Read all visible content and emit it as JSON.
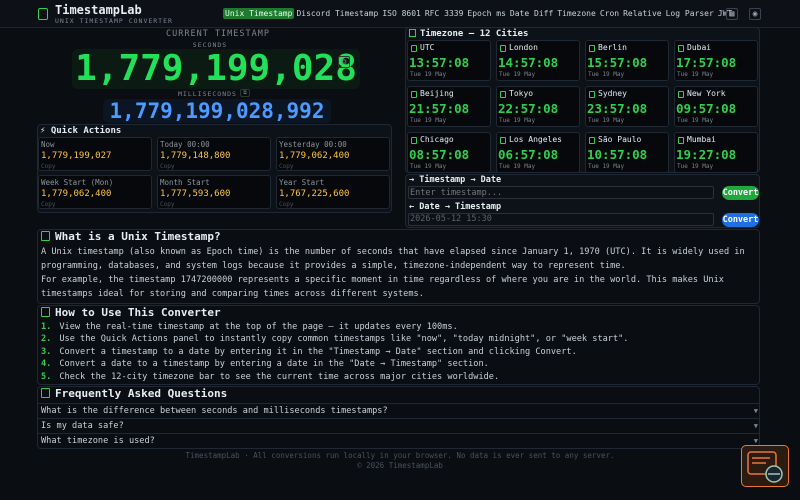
{
  "header": {
    "brand": "TimestampLab",
    "brand_sub": "UNIX TIMESTAMP CONVERTER",
    "nav": [
      "Unix Timestamp",
      "Discord Timestamp",
      "ISO 8601",
      "RFC 3339",
      "Epoch ms",
      "Date Diff",
      "Timezone",
      "Cron",
      "Relative",
      "Log Parser",
      "JWT"
    ],
    "active_nav": "Unix Timestamp",
    "icons": [
      "clock-logo-icon",
      "grid-icon",
      "user-icon"
    ]
  },
  "current": {
    "label": "CURRENT TIMESTAMP",
    "seconds_label": "SECONDS",
    "seconds": "1,779,199,028",
    "ms_label": "MILLISECONDS",
    "ms": "1,779,199,028,992"
  },
  "quick_actions": {
    "title": "⚡ Quick Actions",
    "copy_label": "Copy",
    "items": [
      {
        "label": "Now",
        "value": "1,779,199,027"
      },
      {
        "label": "Today 00:00",
        "value": "1,779,148,800"
      },
      {
        "label": "Yesterday 00:00",
        "value": "1,779,062,400"
      },
      {
        "label": "Week Start (Mon)",
        "value": "1,779,062,400"
      },
      {
        "label": "Month Start",
        "value": "1,777,593,600"
      },
      {
        "label": "Year Start",
        "value": "1,767,225,600"
      }
    ]
  },
  "timezones": {
    "title": "Timezone — 12 Cities",
    "cities": [
      {
        "city": "UTC",
        "time": "13:57:08",
        "date": "Tue 19 May"
      },
      {
        "city": "London",
        "time": "14:57:08",
        "date": "Tue 19 May"
      },
      {
        "city": "Berlin",
        "time": "15:57:08",
        "date": "Tue 19 May"
      },
      {
        "city": "Dubai",
        "time": "17:57:08",
        "date": "Tue 19 May"
      },
      {
        "city": "Beijing",
        "time": "21:57:08",
        "date": "Tue 19 May"
      },
      {
        "city": "Tokyo",
        "time": "22:57:08",
        "date": "Tue 19 May"
      },
      {
        "city": "Sydney",
        "time": "23:57:08",
        "date": "Tue 19 May"
      },
      {
        "city": "New York",
        "time": "09:57:08",
        "date": "Tue 19 May"
      },
      {
        "city": "Chicago",
        "time": "08:57:08",
        "date": "Tue 19 May"
      },
      {
        "city": "Los Angeles",
        "time": "06:57:08",
        "date": "Tue 19 May"
      },
      {
        "city": "São Paulo",
        "time": "10:57:08",
        "date": "Tue 19 May"
      },
      {
        "city": "Mumbai",
        "time": "19:27:08",
        "date": "Tue 19 May"
      }
    ]
  },
  "converter": {
    "ts_to_date_title": "→ Timestamp → Date",
    "ts_placeholder": "Enter timestamp...",
    "date_to_ts_title": "← Date → Timestamp",
    "date_value": "2026-05-12 15:30",
    "convert_label": "Convert"
  },
  "about": {
    "title": "What is a Unix Timestamp?",
    "p1": "A Unix timestamp (also known as Epoch time) is the number of seconds that have elapsed since January 1, 1970 (UTC). It is widely used in programming, databases, and system logs because it provides a simple, timezone-independent way to represent time.",
    "p2": "For example, the timestamp 1747200000 represents a specific moment in time regardless of where you are in the world. This makes Unix timestamps ideal for storing and comparing times across different systems."
  },
  "howto": {
    "title": "How to Use This Converter",
    "steps": [
      {
        "n": "1.",
        "t": "View the real-time timestamp at the top of the page — it updates every 100ms."
      },
      {
        "n": "2.",
        "t": "Use the Quick Actions panel to instantly copy common timestamps like \"now\", \"today midnight\", or \"week start\"."
      },
      {
        "n": "3.",
        "t": "Convert a timestamp to a date by entering it in the \"Timestamp → Date\" section and clicking Convert."
      },
      {
        "n": "4.",
        "t": "Convert a date to a timestamp by entering a date in the \"Date → Timestamp\" section."
      },
      {
        "n": "5.",
        "t": "Check the 12-city timezone bar to see the current time across major cities worldwide."
      }
    ]
  },
  "faq": {
    "title": "Frequently Asked Questions",
    "items": [
      "What is the difference between seconds and milliseconds timestamps?",
      "Is my data safe?",
      "What timezone is used?"
    ]
  },
  "footer": {
    "line1": "TimestampLab · All conversions run locally in your browser. No data is ever sent to any server.",
    "line2": "© 2026 TimestampLab"
  },
  "colors": {
    "accent": "#23e05a",
    "ms": "#4c9bff",
    "value": "#ffc53d",
    "convert_green": "#1fa83c",
    "convert_blue": "#1f6fe0"
  }
}
